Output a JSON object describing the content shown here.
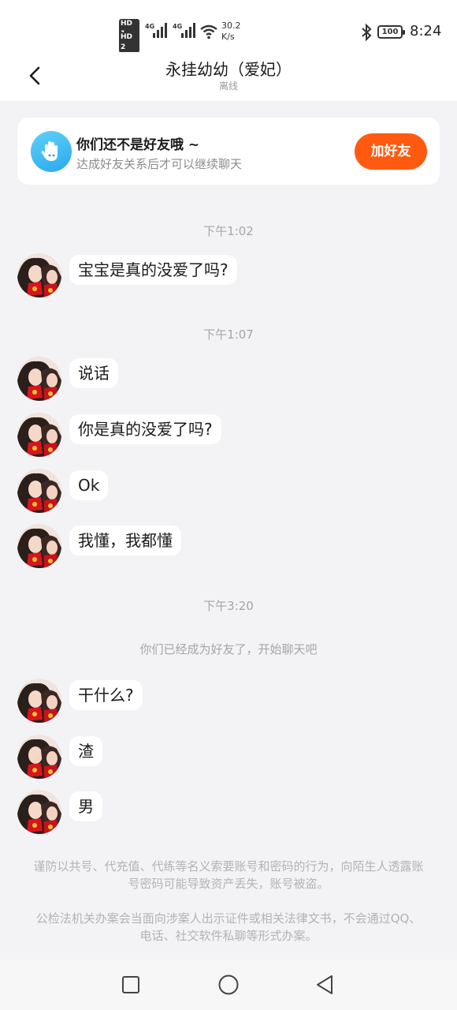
{
  "status_bar": {
    "hd1": "HD 1",
    "hd2": "HD 2",
    "net1": "4G",
    "net2": "4G",
    "speed_value": "30.2",
    "speed_unit": "K/s",
    "battery": "100",
    "time": "8:24",
    "icons": [
      "signal-icon",
      "wifi-icon",
      "bluetooth-icon",
      "battery-icon"
    ]
  },
  "header": {
    "title": "永挂幼幼（爱妃）",
    "status": "离线"
  },
  "friend_card": {
    "title": "你们还不是好友哦 ~",
    "subtitle": "达成好友关系后才可以继续聊天",
    "button_label": "加好友",
    "accent": "#ff5a0f",
    "icon": "hand-icon"
  },
  "messages": {
    "time1": "下午1:02",
    "m1": "宝宝是真的没爱了吗?",
    "time2": "下午1:07",
    "m2": "说话",
    "m3": "你是真的没爱了吗?",
    "m4": "Ok",
    "m5": "我懂，我都懂",
    "time3": "下午3:20",
    "system": "你们已经成为好友了，开始聊天吧",
    "m6": "干什么?",
    "m7": "渣",
    "m8": "男"
  },
  "notices": {
    "n1": "谨防以共号、代充值、代练等名义索要账号和密码的行为，向陌生人透露账号密码可能导致资产丢失，账号被盗。",
    "n2": "公检法机关办案会当面向涉案人出示证件或相关法律文书，不会通过QQ、电话、社交软件私聊等形式办案。"
  },
  "nav": {
    "icons": [
      "recent-apps-icon",
      "home-icon",
      "back-nav-icon"
    ]
  }
}
